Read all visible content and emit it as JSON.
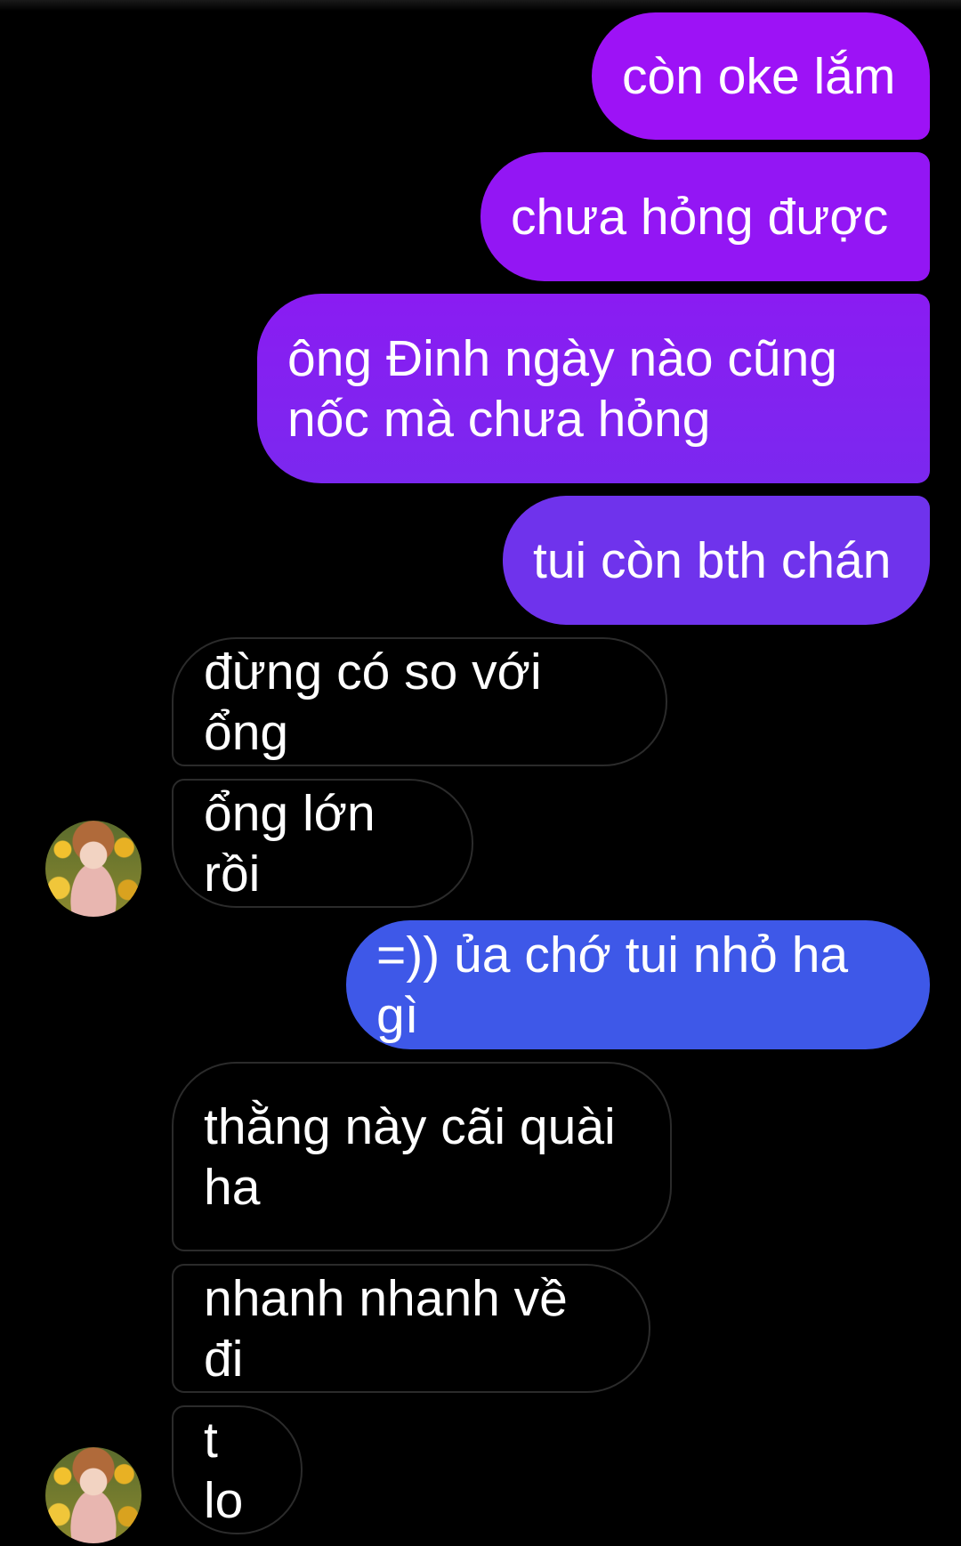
{
  "colors": {
    "background": "#000000",
    "outgoing_gradient_top": "#9b10f5",
    "outgoing_gradient_bottom": "#3b5fe6",
    "incoming_border": "#2b2b2b",
    "text": "#ffffff"
  },
  "messages": [
    {
      "from": "me",
      "text": "còn oke lắm"
    },
    {
      "from": "me",
      "text": "chưa hỏng được"
    },
    {
      "from": "me",
      "text": "ông Đinh ngày nào cũng\nnốc mà chưa hỏng"
    },
    {
      "from": "me",
      "text": "tui còn bth chán"
    },
    {
      "from": "them",
      "text": "đừng có so với ổng"
    },
    {
      "from": "them",
      "text": "ổng lớn rồi"
    },
    {
      "from": "me",
      "text": "=)) ủa chớ tui nhỏ ha gì"
    },
    {
      "from": "them",
      "text": "thằng này cãi quài\nha"
    },
    {
      "from": "them",
      "text": "nhanh nhanh về đi"
    },
    {
      "from": "them",
      "text": "t lo"
    }
  ],
  "avatar": {
    "icon": "contact-avatar-photo"
  }
}
